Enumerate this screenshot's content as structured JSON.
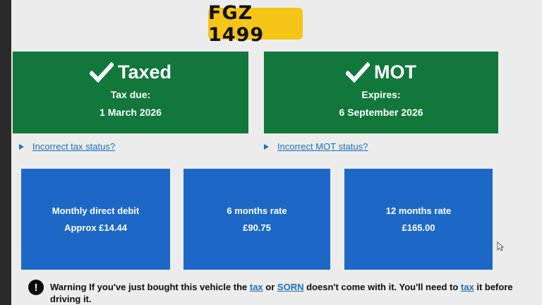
{
  "registration": "FGZ 1499",
  "tax": {
    "status": "Taxed",
    "label": "Tax due:",
    "date": "1 March 2026",
    "link": "Incorrect tax status?",
    "icon": "check-icon"
  },
  "mot": {
    "status": "MOT",
    "label": "Expires:",
    "date": "6 September 2026",
    "link": "Incorrect MOT status?",
    "icon": "check-icon"
  },
  "rates": [
    {
      "title": "Monthly direct debit",
      "amount": "Approx £14.44"
    },
    {
      "title": "6 months rate",
      "amount": "£90.75"
    },
    {
      "title": "12 months rate",
      "amount": "£165.00"
    }
  ],
  "warning": {
    "icon_glyph": "!",
    "prefix": "Warning If you've just bought this vehicle the",
    "link_tax": "tax",
    "or": "or",
    "link_sorn": "SORN",
    "middle": "doesn't come with it. You'll need to",
    "link_tax2": "tax",
    "suffix": "it before driving it."
  },
  "colors": {
    "green": "#11773a",
    "blue": "#1d68c7",
    "link": "#1d70b8",
    "plate": "#f5c518"
  }
}
